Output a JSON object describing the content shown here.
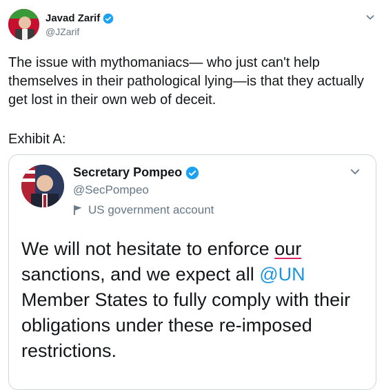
{
  "tweet": {
    "author_name": "Javad Zarif",
    "author_handle": "@JZarif",
    "text": "The issue with mythomaniacs— who just can't help themselves in their pathological lying—is that they actually get lost in their own web of deceit.",
    "exhibit": "Exhibit A:"
  },
  "quoted_tweet": {
    "author_name": "Secretary Pompeo",
    "author_handle": "@SecPompeo",
    "label": "US government account",
    "text_part1": "We will not hesitate to enforce ",
    "text_our": "our",
    "text_part2": " sanctions, and we expect all ",
    "text_mention": "@UN",
    "text_part3": " Member States to fully comply with their obligations under these re-imposed restrictions."
  },
  "colors": {
    "verified": "#1da1f2",
    "link": "#1b95e0",
    "secondary_text": "#657786",
    "border": "#ccd6dd"
  }
}
